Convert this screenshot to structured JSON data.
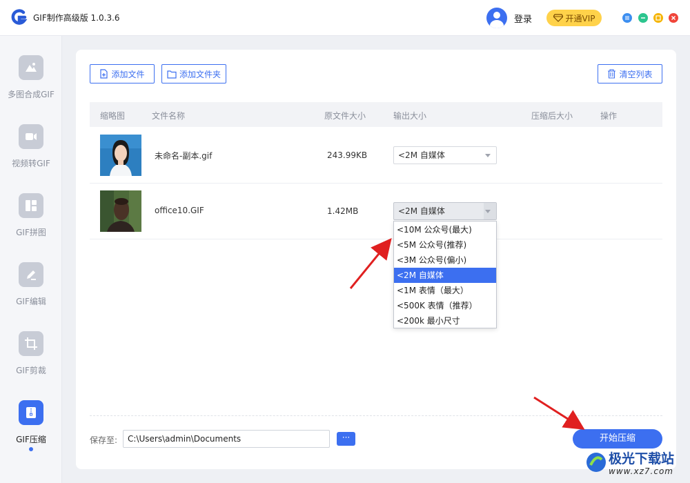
{
  "app": {
    "title": "GIF制作高级版 1.0.3.6"
  },
  "header": {
    "login_label": "登录",
    "vip_label": "开通VIP"
  },
  "sidebar": {
    "items": [
      {
        "label": "多图合成GIF",
        "icon": "mountain-image-icon",
        "active": false
      },
      {
        "label": "视频转GIF",
        "icon": "video-camera-icon",
        "active": false
      },
      {
        "label": "GIF拼图",
        "icon": "grid-layout-icon",
        "active": false
      },
      {
        "label": "GIF编辑",
        "icon": "pencil-edit-icon",
        "active": false
      },
      {
        "label": "GIF剪裁",
        "icon": "crop-icon",
        "active": false
      },
      {
        "label": "GIF压缩",
        "icon": "compress-file-icon",
        "active": true
      }
    ]
  },
  "toolbar": {
    "add_file_label": "添加文件",
    "add_folder_label": "添加文件夹",
    "clear_list_label": "清空列表"
  },
  "table": {
    "columns": [
      "缩略图",
      "文件名称",
      "原文件大小",
      "输出大小",
      "压缩后大小",
      "操作"
    ],
    "rows": [
      {
        "name": "未命名-副本.gif",
        "size": "243.99KB",
        "output": "<2M 自媒体",
        "thumb": "portrait-woman"
      },
      {
        "name": "office10.GIF",
        "size": "1.42MB",
        "output": "<2M 自媒体",
        "thumb": "portrait-man"
      }
    ]
  },
  "output_options": [
    "<10M 公众号(最大)",
    "<5M 公众号(推荐)",
    "<3M 公众号(偏小)",
    "<2M 自媒体",
    "<1M 表情（最大）",
    "<500K 表情（推荐）",
    "<200k 最小尺寸"
  ],
  "selected_option_index": 3,
  "footer": {
    "save_label": "保存至:",
    "save_path": "C:\\Users\\admin\\Documents",
    "browse_label": "···",
    "start_label": "开始压缩"
  },
  "watermark": {
    "line1": "极光下载站",
    "line2": "www.xz7.com"
  },
  "colors": {
    "accent": "#3c6ff0",
    "vip": "#ffd24a",
    "arrow": "#e02020"
  }
}
